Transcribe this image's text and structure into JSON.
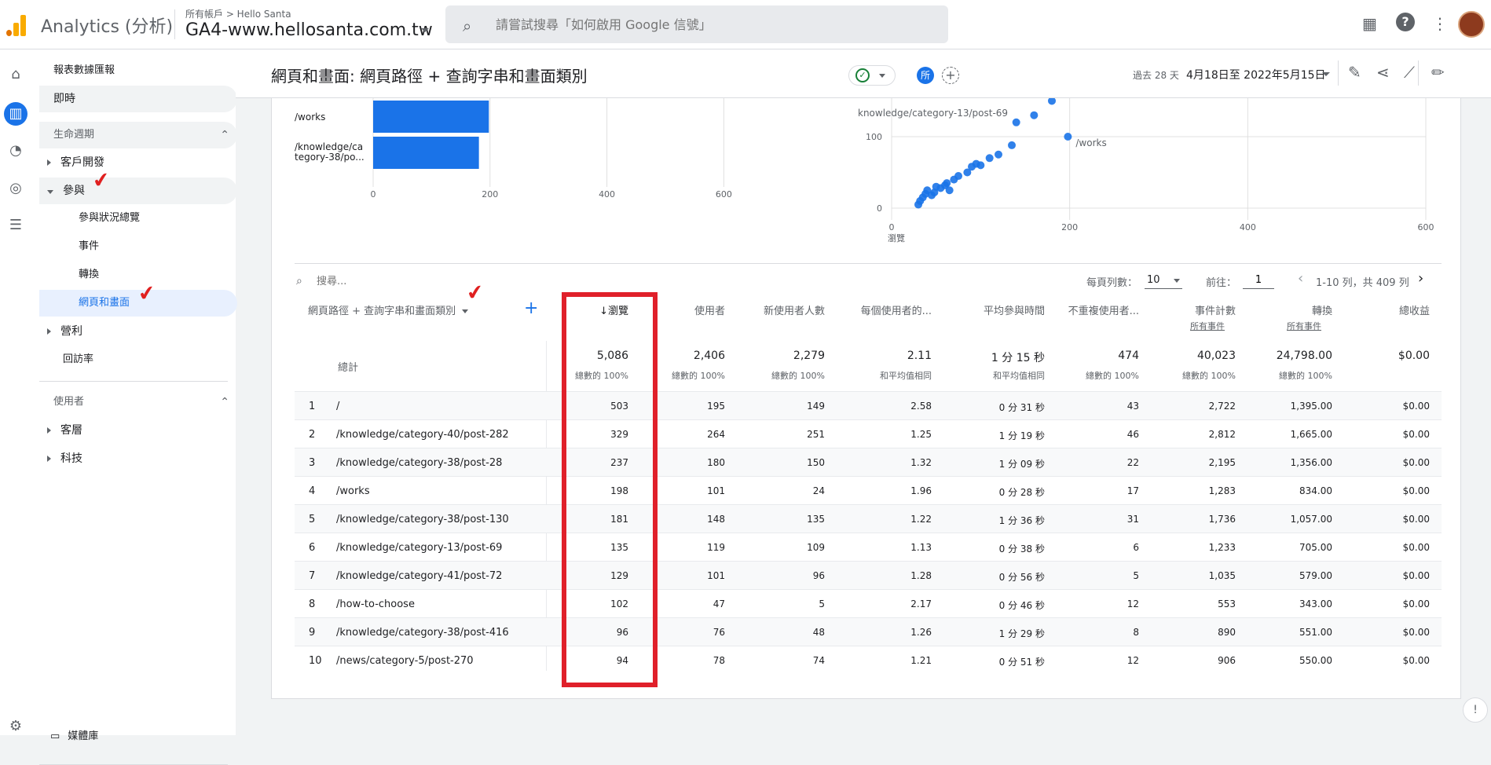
{
  "app": {
    "name": "Analytics (分析)"
  },
  "account": {
    "crumb": "所有帳戶 > Hello Santa",
    "property": "GA4-www.hellosanta.com.tw"
  },
  "search": {
    "placeholder": "請嘗試搜尋「如何啟用 Google 信號」"
  },
  "sidebar": {
    "items": [
      {
        "label": "報表數據匯報"
      },
      {
        "label": "即時"
      },
      {
        "label": "生命週期"
      },
      {
        "label": "客戶開發"
      },
      {
        "label": "參與"
      },
      {
        "label": "參與狀況總覽"
      },
      {
        "label": "事件"
      },
      {
        "label": "轉換"
      },
      {
        "label": "網頁和畫面"
      },
      {
        "label": "營利"
      },
      {
        "label": "回訪率"
      },
      {
        "label": "使用者"
      },
      {
        "label": "客層"
      },
      {
        "label": "科技"
      },
      {
        "label": "媒體庫"
      }
    ]
  },
  "header": {
    "title": "網頁和畫面: 網頁路徑 + 查詢字串和畫面類別",
    "comparison_chip": "所",
    "date_label": "過去 28 天",
    "date_range": "4月18日至 2022年5月15日"
  },
  "bar_chart": {
    "type": "bar",
    "categories": [
      "/works",
      "/knowledge/category-38/po..."
    ],
    "category_lines": [
      [
        "/works"
      ],
      [
        "/knowledge/ca",
        "tegory-38/po..."
      ]
    ],
    "values": [
      198,
      181
    ],
    "x_ticks": [
      "0",
      "200",
      "400",
      "600"
    ],
    "xlim": [
      0,
      600
    ],
    "color": "#1a73e8"
  },
  "scatter_chart": {
    "type": "scatter",
    "x_ticks": [
      "0",
      "200",
      "400",
      "600"
    ],
    "y_ticks": [
      "0",
      "100"
    ],
    "xlim": [
      0,
      600
    ],
    "ylim": [
      0,
      100
    ],
    "xlabel": "瀏覽",
    "annotations": [
      "knowledge/category-13/post-69",
      "/works"
    ],
    "points": [
      [
        30,
        5
      ],
      [
        32,
        10
      ],
      [
        35,
        15
      ],
      [
        38,
        20
      ],
      [
        40,
        25
      ],
      [
        45,
        18
      ],
      [
        48,
        22
      ],
      [
        50,
        30
      ],
      [
        55,
        28
      ],
      [
        60,
        32
      ],
      [
        62,
        35
      ],
      [
        65,
        25
      ],
      [
        70,
        40
      ],
      [
        75,
        45
      ],
      [
        85,
        50
      ],
      [
        90,
        58
      ],
      [
        95,
        62
      ],
      [
        100,
        60
      ],
      [
        110,
        70
      ],
      [
        120,
        75
      ],
      [
        135,
        88
      ],
      [
        140,
        120
      ],
      [
        160,
        130
      ],
      [
        180,
        150
      ],
      [
        198,
        100
      ]
    ],
    "color": "#1a73e8"
  },
  "table": {
    "search_placeholder": "搜尋...",
    "rows_per_page_label": "每頁列數：",
    "rows_per_page": "10",
    "goto_label": "前往：",
    "goto_value": "1",
    "pagination": "1-10 列，共 409 列",
    "dimension_header": "網頁路徑 + 查詢字串和畫面類別",
    "totals_label": "總計",
    "columns": [
      {
        "label": "↓瀏覽",
        "sub": "",
        "total": "5,086",
        "total_sub": "總數的 100%"
      },
      {
        "label": "使用者",
        "sub": "",
        "total": "2,406",
        "total_sub": "總數的 100%"
      },
      {
        "label": "新使用者人數",
        "sub": "",
        "total": "2,279",
        "total_sub": "總數的 100%"
      },
      {
        "label": "每個使用者的...",
        "sub": "",
        "total": "2.11",
        "total_sub": "和平均值相同"
      },
      {
        "label": "平均參與時間",
        "sub": "",
        "total": "1 分 15 秒",
        "total_sub": "和平均值相同"
      },
      {
        "label": "不重複使用者...",
        "sub": "",
        "total": "474",
        "total_sub": "總數的 100%"
      },
      {
        "label": "事件計數",
        "sub": "所有事件",
        "total": "40,023",
        "total_sub": "總數的 100%"
      },
      {
        "label": "轉換",
        "sub": "所有事件",
        "total": "24,798.00",
        "total_sub": "總數的 100%"
      },
      {
        "label": "總收益",
        "sub": "",
        "total": "$0.00",
        "total_sub": ""
      }
    ],
    "rows": [
      {
        "idx": "1",
        "path": "/",
        "vals": [
          "503",
          "195",
          "149",
          "2.58",
          "0 分 31 秒",
          "43",
          "2,722",
          "1,395.00",
          "$0.00"
        ]
      },
      {
        "idx": "2",
        "path": "/knowledge/category-40/post-282",
        "vals": [
          "329",
          "264",
          "251",
          "1.25",
          "1 分 19 秒",
          "46",
          "2,812",
          "1,665.00",
          "$0.00"
        ]
      },
      {
        "idx": "3",
        "path": "/knowledge/category-38/post-28",
        "vals": [
          "237",
          "180",
          "150",
          "1.32",
          "1 分 09 秒",
          "22",
          "2,195",
          "1,356.00",
          "$0.00"
        ]
      },
      {
        "idx": "4",
        "path": "/works",
        "vals": [
          "198",
          "101",
          "24",
          "1.96",
          "0 分 28 秒",
          "17",
          "1,283",
          "834.00",
          "$0.00"
        ]
      },
      {
        "idx": "5",
        "path": "/knowledge/category-38/post-130",
        "vals": [
          "181",
          "148",
          "135",
          "1.22",
          "1 分 36 秒",
          "31",
          "1,736",
          "1,057.00",
          "$0.00"
        ]
      },
      {
        "idx": "6",
        "path": "/knowledge/category-13/post-69",
        "vals": [
          "135",
          "119",
          "109",
          "1.13",
          "0 分 38 秒",
          "6",
          "1,233",
          "705.00",
          "$0.00"
        ]
      },
      {
        "idx": "7",
        "path": "/knowledge/category-41/post-72",
        "vals": [
          "129",
          "101",
          "96",
          "1.28",
          "0 分 56 秒",
          "5",
          "1,035",
          "579.00",
          "$0.00"
        ]
      },
      {
        "idx": "8",
        "path": "/how-to-choose",
        "vals": [
          "102",
          "47",
          "5",
          "2.17",
          "0 分 46 秒",
          "12",
          "553",
          "343.00",
          "$0.00"
        ]
      },
      {
        "idx": "9",
        "path": "/knowledge/category-38/post-416",
        "vals": [
          "96",
          "76",
          "48",
          "1.26",
          "1 分 29 秒",
          "8",
          "890",
          "551.00",
          "$0.00"
        ]
      },
      {
        "idx": "10",
        "path": "/news/category-5/post-270",
        "vals": [
          "94",
          "78",
          "74",
          "1.21",
          "0 分 51 秒",
          "12",
          "906",
          "550.00",
          "$0.00"
        ]
      }
    ]
  },
  "colors": {
    "accent": "#1a73e8",
    "highlight_box": "#e0202a"
  }
}
